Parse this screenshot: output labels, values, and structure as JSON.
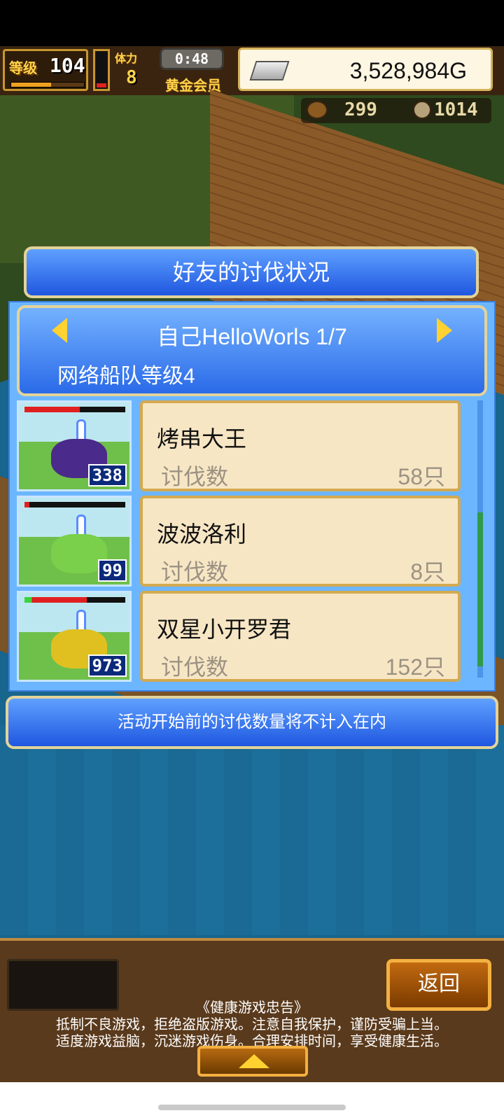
{
  "hud": {
    "level_label": "等级",
    "level_value": "104",
    "level_progress": 0.55,
    "stamina_label": "体力",
    "stamina_value": "8",
    "timer": "0:48",
    "membership": "黄金会员",
    "gold": "3,528,984G",
    "resource_1": "299",
    "resource_2": "1014"
  },
  "panel": {
    "title": "好友的讨伐状况",
    "friend_name": "自己HelloWorls 1/7",
    "fleet_level": "网络船队等级4",
    "rows": [
      {
        "name": "烤串大王",
        "kill_label": "讨伐数",
        "kills": "58只",
        "thumb_count": "338",
        "hp_fraction": 0.55,
        "hp_color": "red",
        "monster_color": "#4a2a8a"
      },
      {
        "name": "波波洛利",
        "kill_label": "讨伐数",
        "kills": "8只",
        "thumb_count": "99",
        "hp_fraction": 0.05,
        "hp_color": "red",
        "monster_color": "#7ad04a"
      },
      {
        "name": "双星小开罗君",
        "kill_label": "讨伐数",
        "kills": "152只",
        "thumb_count": "973",
        "hp_fraction": 0.62,
        "hp_color": "mixed",
        "monster_color": "#e0c020"
      }
    ],
    "notice": "活动开始前的讨伐数量将不计入在内"
  },
  "footer": {
    "back_label": "返回",
    "advisory_title": "《健康游戏忠告》",
    "advisory_line1": "抵制不良游戏，拒绝盗版游戏。注意自我保护，谨防受骗上当。",
    "advisory_line2": "适度游戏益脑，沉迷游戏伤身。合理安排时间，享受健康生活。"
  },
  "colors": {
    "panel_blue": "#1f57e0",
    "card_bg": "#f7e6c4",
    "gold_border": "#e3d39a",
    "accent_yellow": "#ffd231"
  }
}
